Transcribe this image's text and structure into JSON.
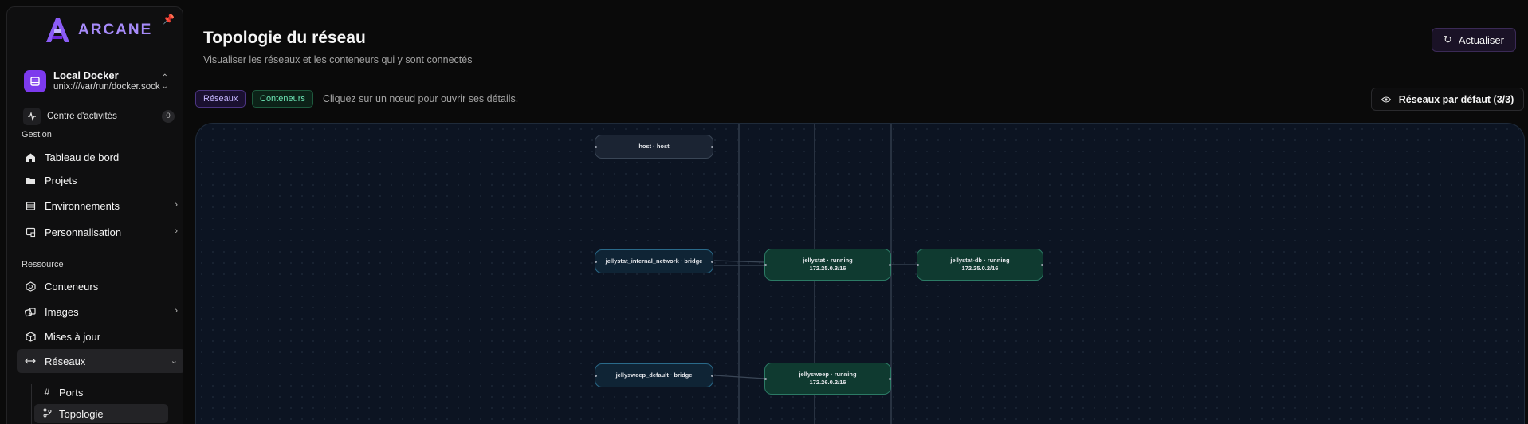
{
  "app": {
    "brand": "ARCANE"
  },
  "sidebar": {
    "environment": {
      "name": "Local Docker",
      "socket": "unix:///var/run/docker.sock"
    },
    "activity": {
      "label": "Centre d'activités",
      "count": "0"
    },
    "sections": {
      "management": "Gestion",
      "resource": "Ressource"
    },
    "items": {
      "dashboard": "Tableau de bord",
      "projects": "Projets",
      "environments": "Environnements",
      "customization": "Personnalisation",
      "containers": "Conteneurs",
      "images": "Images",
      "updates": "Mises à jour",
      "networks": "Réseaux",
      "ports": "Ports",
      "topology": "Topologie"
    }
  },
  "header": {
    "title": "Topologie du réseau",
    "subtitle": "Visualiser les réseaux et les conteneurs qui y sont connectés",
    "refresh_label": "Actualiser"
  },
  "toolbar": {
    "chip_networks": "Réseaux",
    "chip_containers": "Conteneurs",
    "hint": "Cliquez sur un nœud pour ouvrir ses détails.",
    "default_networks": "Réseaux par défaut (3/3)"
  },
  "topology": {
    "nodes": {
      "host": {
        "label": "host · host"
      },
      "jellystat_net": {
        "label": "jellystat_internal_network · bridge"
      },
      "jellystat": {
        "label": "jellystat · running",
        "ip": "172.25.0.3/16"
      },
      "jellystat_db": {
        "label": "jellystat-db · running",
        "ip": "172.25.0.2/16"
      },
      "jellysweep_net": {
        "label": "jellysweep_default · bridge"
      },
      "jellysweep": {
        "label": "jellysweep · running",
        "ip": "172.26.0.2/16"
      }
    }
  },
  "colors": {
    "accent": "#7c3aed",
    "network_node": "#0f2435",
    "container_node": "#0f3a30",
    "canvas": "#0c1422"
  }
}
